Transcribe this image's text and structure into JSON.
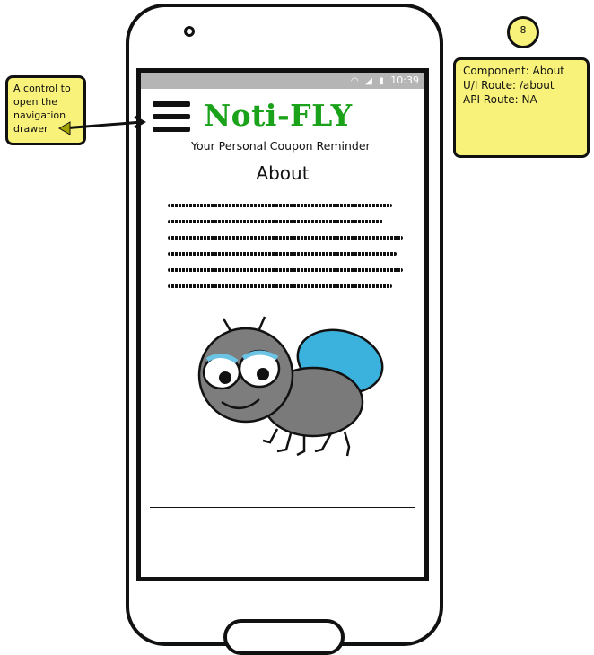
{
  "status_bar": {
    "time": "10:39",
    "icons": [
      "wifi-icon",
      "signal-icon",
      "battery-icon"
    ]
  },
  "app": {
    "brand": "Noti-FLY",
    "tagline": "Your Personal Coupon Reminder",
    "page_title": "About",
    "brand_color": "#1aa21a"
  },
  "annotations": {
    "drawer_note": "A control to open the navigation drawer",
    "component_number": "8",
    "component_lines": [
      "Component: About",
      "U/I Route: /about",
      "API Route: NA"
    ],
    "note_color": "#f8f27a"
  }
}
